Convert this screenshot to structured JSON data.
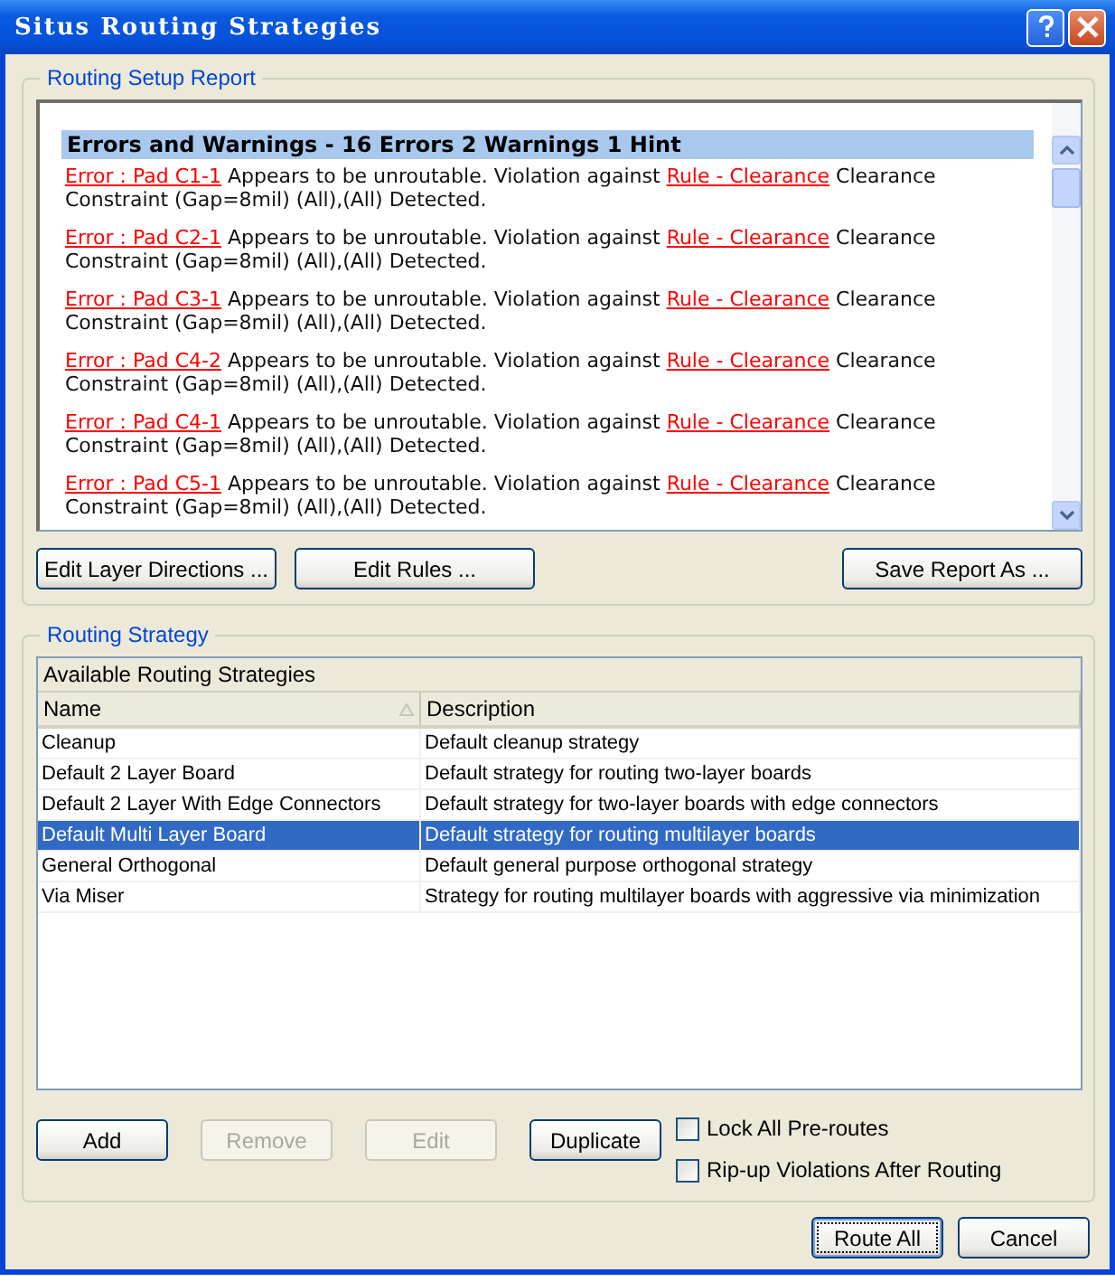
{
  "window": {
    "title": "Situs Routing Strategies"
  },
  "report": {
    "group_title": "Routing Setup Report",
    "heading": "Errors and Warnings - 16 Errors 2 Warnings 1 Hint",
    "entries": [
      {
        "pad": "Error : Pad C1-1",
        "text": "Appears to be unroutable. Violation against",
        "rule": "Rule - Clearance",
        "tail": "Clearance Constraint (Gap=8mil) (All),(All) Detected."
      },
      {
        "pad": "Error : Pad C2-1",
        "text": "Appears to be unroutable. Violation against",
        "rule": "Rule - Clearance",
        "tail": "Clearance Constraint (Gap=8mil) (All),(All) Detected."
      },
      {
        "pad": "Error : Pad C3-1",
        "text": "Appears to be unroutable. Violation against",
        "rule": "Rule - Clearance",
        "tail": "Clearance Constraint (Gap=8mil) (All),(All) Detected."
      },
      {
        "pad": "Error : Pad C4-2",
        "text": "Appears to be unroutable. Violation against",
        "rule": "Rule - Clearance",
        "tail": "Clearance Constraint (Gap=8mil) (All),(All) Detected."
      },
      {
        "pad": "Error : Pad C4-1",
        "text": "Appears to be unroutable. Violation against",
        "rule": "Rule - Clearance",
        "tail": "Clearance Constraint (Gap=8mil) (All),(All) Detected."
      },
      {
        "pad": "Error : Pad C5-1",
        "text": "Appears to be unroutable. Violation against",
        "rule": "Rule - Clearance",
        "tail": "Clearance Constraint (Gap=8mil) (All),(All) Detected."
      }
    ],
    "buttons": [
      {
        "label": "Edit Layer Directions ..."
      },
      {
        "label": "Edit Rules ..."
      },
      {
        "label": "Save Report As ..."
      }
    ]
  },
  "strategy": {
    "group_title": "Routing Strategy",
    "table_title": "Available Routing Strategies",
    "columns": [
      "Name",
      "Description"
    ],
    "rows": [
      {
        "name": "Cleanup",
        "description": "Default cleanup strategy",
        "selected": false
      },
      {
        "name": "Default 2 Layer Board",
        "description": "Default strategy for routing two-layer boards",
        "selected": false
      },
      {
        "name": "Default 2 Layer With Edge Connectors",
        "description": "Default strategy for two-layer boards with edge connectors",
        "selected": false
      },
      {
        "name": "Default Multi Layer Board",
        "description": "Default strategy for routing multilayer boards",
        "selected": true
      },
      {
        "name": "General Orthogonal",
        "description": "Default general purpose orthogonal strategy",
        "selected": false
      },
      {
        "name": "Via Miser",
        "description": "Strategy for routing multilayer boards with aggressive via minimization",
        "selected": false
      }
    ],
    "buttons": [
      {
        "label": "Add",
        "disabled": false
      },
      {
        "label": "Remove",
        "disabled": true
      },
      {
        "label": "Edit",
        "disabled": true
      },
      {
        "label": "Duplicate",
        "disabled": false
      }
    ],
    "options": [
      {
        "label": "Lock All Pre-routes",
        "checked": false
      },
      {
        "label": "Rip-up Violations After Routing",
        "checked": false
      }
    ]
  },
  "footer_buttons": [
    {
      "label": "Route All"
    },
    {
      "label": "Cancel"
    }
  ]
}
